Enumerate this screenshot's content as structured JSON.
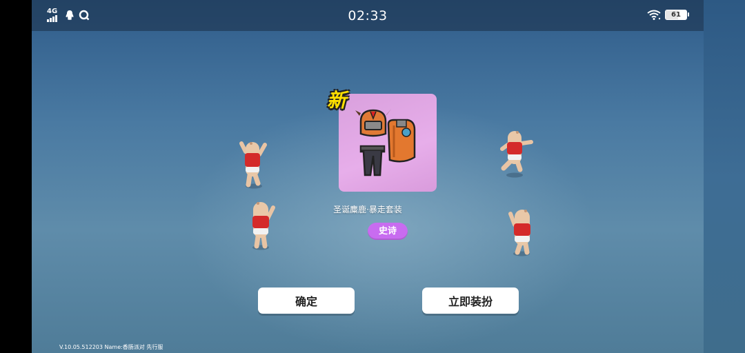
{
  "status_bar": {
    "network": "4G",
    "time": "02:33",
    "battery": "61",
    "battery_level": 0.61,
    "icons": [
      "signal-icon",
      "qq-icon",
      "q-app-icon",
      "wifi-icon",
      "battery-icon"
    ]
  },
  "reward": {
    "badge": "新",
    "item_name": "圣诞麋鹿·暴走套装",
    "rarity": "史诗",
    "card_color": "#e0a6e3",
    "rarity_color": "#c86cf0"
  },
  "buttons": {
    "confirm": "确定",
    "equip": "立即装扮"
  },
  "footer": {
    "version": "V.10.05.512203 Name:香肠派对 先行服"
  }
}
